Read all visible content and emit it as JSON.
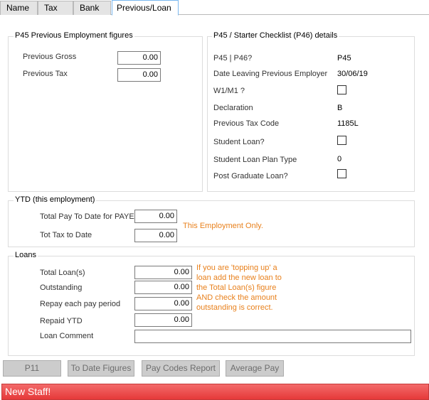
{
  "tabs": [
    "Name",
    "Tax",
    "Bank",
    "Previous/Loan"
  ],
  "p45": {
    "title": "P45 Previous Employment figures",
    "previous_gross_label": "Previous Gross",
    "previous_gross_value": "0.00",
    "previous_tax_label": "Previous Tax",
    "previous_tax_value": "0.00"
  },
  "starter": {
    "title": "P45 / Starter Checklist (P46) details",
    "p45_p46_label": "P45 | P46?",
    "p45_p46_value": "P45",
    "date_leaving_label": "Date Leaving Previous Employer",
    "date_leaving_value": "30/06/19",
    "w1m1_label": "W1/M1 ?",
    "w1m1_checked": false,
    "declaration_label": "Declaration",
    "declaration_value": "B",
    "prev_tax_code_label": "Previous Tax Code",
    "prev_tax_code_value": "1185L",
    "student_loan_label": "Student Loan?",
    "student_loan_checked": false,
    "student_loan_plan_label": "Student Loan Plan Type",
    "student_loan_plan_value": "0",
    "post_grad_label": "Post Graduate Loan?",
    "post_grad_checked": false
  },
  "ytd": {
    "title": "YTD (this employment)",
    "total_pay_label": "Total Pay To Date for PAYE",
    "total_pay_value": "0.00",
    "tot_tax_label": "Tot Tax to Date",
    "tot_tax_value": "0.00",
    "note": "This Employment Only."
  },
  "loans": {
    "title": "Loans",
    "total_loans_label": "Total Loan(s)",
    "total_loans_value": "0.00",
    "outstanding_label": "Outstanding",
    "outstanding_value": "0.00",
    "repay_label": "Repay each pay period",
    "repay_value": "0.00",
    "repaid_ytd_label": "Repaid YTD",
    "repaid_ytd_value": "0.00",
    "comment_label": "Loan Comment",
    "comment_value": "",
    "note_lines": [
      "If you are 'topping up' a",
      "loan add the new loan to",
      "the Total Loan(s) figure",
      "AND check the amount",
      "outstanding is correct."
    ]
  },
  "buttons": {
    "p11": "P11",
    "to_date_figures": "To Date Figures",
    "pay_codes_report": "Pay Codes Report",
    "average_pay": "Average Pay"
  },
  "status": "New Staff!"
}
